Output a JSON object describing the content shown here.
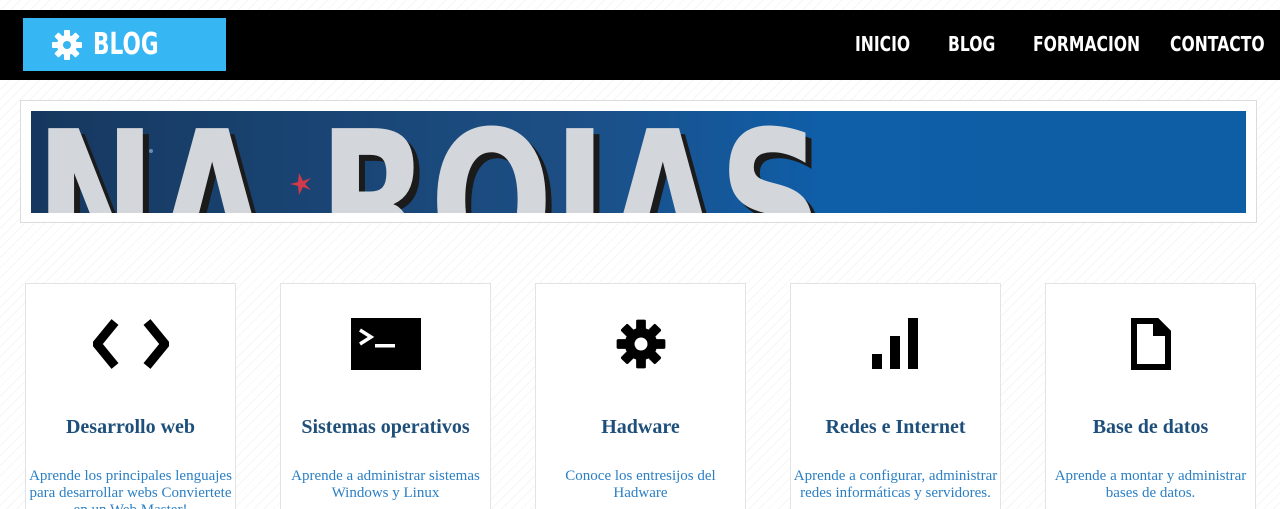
{
  "colors": {
    "accent": "#36b6f2",
    "nav_background": "#000000",
    "card_title": "#1d4f7a",
    "card_text": "#2b7fc4",
    "banner_blue": "#1f5f9f"
  },
  "header": {
    "logo_icon": "gear-icon",
    "logo_text": "BLOG",
    "nav": [
      {
        "label": "INICIO"
      },
      {
        "label": "BLOG"
      },
      {
        "label": "FORMACION"
      },
      {
        "label": "CONTACTO"
      }
    ]
  },
  "banner": {
    "text": "ANA ROJAS"
  },
  "cards": [
    {
      "icon": "code-icon",
      "title": "Desarrollo web",
      "text": "Aprende los principales lenguajes para desarrollar webs Conviertete en un Web Master!"
    },
    {
      "icon": "terminal-icon",
      "title": "Sistemas operativos",
      "text": "Aprende a administrar sistemas Windows y Linux"
    },
    {
      "icon": "gear-icon",
      "title": "Hadware",
      "text": "Conoce los entresijos del Hadware"
    },
    {
      "icon": "signal-bars-icon",
      "title": "Redes e Internet",
      "text": "Aprende a configurar, administrar redes informáticas y servidores."
    },
    {
      "icon": "document-icon",
      "title": "Base de datos",
      "text": "Aprende a montar y administrar bases de datos."
    }
  ]
}
